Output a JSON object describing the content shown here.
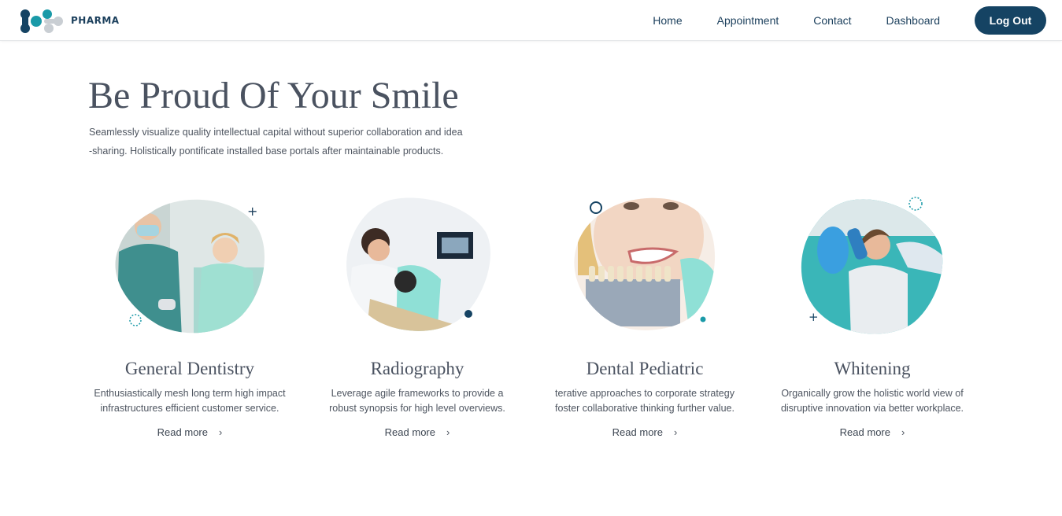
{
  "brand": {
    "name": "PHARMA",
    "logo_icon": "molecule-logo-icon",
    "colors": {
      "navy": "#154363",
      "teal": "#1a9aa8",
      "grey": "#c9ced3"
    }
  },
  "nav": {
    "links": [
      "Home",
      "Appointment",
      "Contact",
      "Dashboard"
    ],
    "logout_label": "Log Out"
  },
  "hero": {
    "title": "Be Proud Of Your Smile",
    "subtitle_line1": "Seamlessly visualize quality intellectual capital without superior collaboration and idea",
    "subtitle_line2": "-sharing. Holistically pontificate installed base portals after maintainable products."
  },
  "services": [
    {
      "title": "General Dentistry",
      "desc_line1": "Enthusiastically mesh long term high impact",
      "desc_line2": "infrastructures efficient customer service.",
      "read_more": "Read more",
      "image": "dentist-with-patient-photo"
    },
    {
      "title": "Radiography",
      "desc_line1": "Leverage agile frameworks to provide a",
      "desc_line2": "robust synopsis for high level overviews.",
      "read_more": "Read more",
      "image": "dental-xray-photo"
    },
    {
      "title": "Dental Pediatric",
      "desc_line1": "terative approaches to corporate strategy",
      "desc_line2": "foster collaborative thinking further value.",
      "read_more": "Read more",
      "image": "teeth-shade-guide-photo"
    },
    {
      "title": "Whitening",
      "desc_line1": "Organically grow the holistic world view of",
      "desc_line2": "disruptive innovation via better workplace.",
      "read_more": "Read more",
      "image": "child-with-mirror-photo"
    }
  ]
}
